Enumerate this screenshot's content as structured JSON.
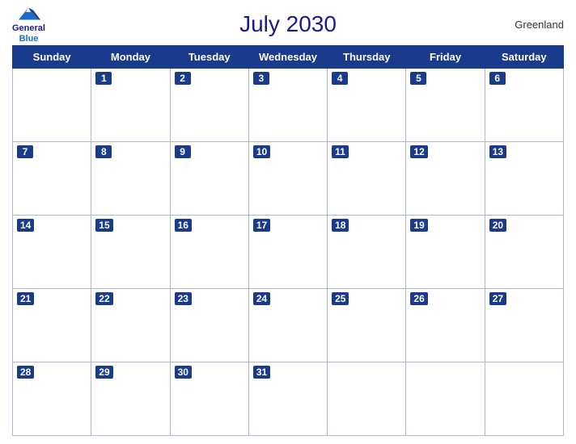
{
  "header": {
    "title": "July 2030",
    "region": "Greenland",
    "logo": {
      "general": "General",
      "blue": "Blue"
    }
  },
  "calendar": {
    "days_of_week": [
      "Sunday",
      "Monday",
      "Tuesday",
      "Wednesday",
      "Thursday",
      "Friday",
      "Saturday"
    ],
    "weeks": [
      [
        "",
        "1",
        "2",
        "3",
        "4",
        "5",
        "6"
      ],
      [
        "7",
        "8",
        "9",
        "10",
        "11",
        "12",
        "13"
      ],
      [
        "14",
        "15",
        "16",
        "17",
        "18",
        "19",
        "20"
      ],
      [
        "21",
        "22",
        "23",
        "24",
        "25",
        "26",
        "27"
      ],
      [
        "28",
        "29",
        "30",
        "31",
        "",
        "",
        ""
      ]
    ]
  },
  "colors": {
    "header_bg": "#1a3a8c",
    "header_text": "#ffffff",
    "title_color": "#1a1a8c",
    "day_number_bg": "#1a3a8c",
    "border_color": "#b0b8d0"
  }
}
